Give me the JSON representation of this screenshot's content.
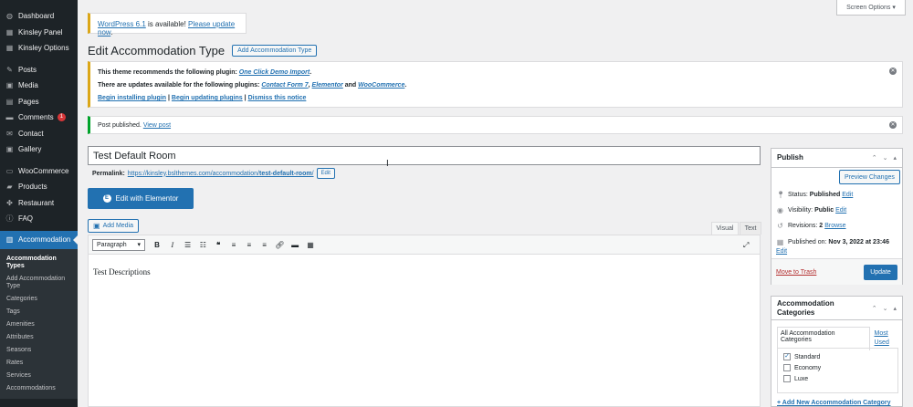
{
  "sidebar": {
    "items_top": [
      {
        "label": "Dashboard",
        "icon": "dashboard-icon",
        "glyph": "◍"
      },
      {
        "label": "Kinsley Panel",
        "icon": "panel-icon",
        "glyph": "▦"
      },
      {
        "label": "Kinsley Options",
        "icon": "options-icon",
        "glyph": "▦"
      }
    ],
    "items_mid": [
      {
        "label": "Posts",
        "icon": "pin-icon",
        "glyph": "✎"
      },
      {
        "label": "Media",
        "icon": "media-icon",
        "glyph": "▣"
      },
      {
        "label": "Pages",
        "icon": "pages-icon",
        "glyph": "▤"
      },
      {
        "label": "Comments",
        "icon": "comments-icon",
        "glyph": "▬",
        "badge": "1"
      },
      {
        "label": "Contact",
        "icon": "mail-icon",
        "glyph": "✉"
      },
      {
        "label": "Gallery",
        "icon": "gallery-icon",
        "glyph": "▣"
      }
    ],
    "items_bottom": [
      {
        "label": "WooCommerce",
        "icon": "woocommerce-icon",
        "glyph": "▭"
      },
      {
        "label": "Products",
        "icon": "products-icon",
        "glyph": "▰"
      },
      {
        "label": "Restaurant",
        "icon": "restaurant-icon",
        "glyph": "✤"
      },
      {
        "label": "FAQ",
        "icon": "faq-icon",
        "glyph": "ⓘ"
      }
    ],
    "active": {
      "label": "Accommodation",
      "icon": "accommodation-icon",
      "glyph": "▥"
    },
    "submenu": [
      "Accommodation Types",
      "Add Accommodation Type",
      "Categories",
      "Tags",
      "Amenities",
      "Attributes",
      "Seasons",
      "Rates",
      "Services",
      "Accommodations"
    ]
  },
  "screen_options": "Screen Options ▾",
  "update_nag": {
    "link": "WordPress 6.1",
    "middle": " is available! ",
    "link2": "Please update now",
    "end": "."
  },
  "heading": {
    "title": "Edit Accommodation Type",
    "add_button": "Add Accommodation Type"
  },
  "theme_notice": {
    "line1_prefix": "This theme recommends the following plugin: ",
    "line1_plugin": "One Click Demo Import",
    "line2_prefix": "There are updates available for the following plugins: ",
    "line2_p1": "Contact Form 7",
    "line2_p2": "Elementor",
    "line2_and": " and ",
    "line2_p3": "WooCommerce",
    "link_install": "Begin installing plugin",
    "link_update": "Begin updating plugins",
    "link_dismiss": "Dismiss this notice",
    "sep": " | "
  },
  "published_notice": {
    "text": "Post published. ",
    "link": "View post"
  },
  "post": {
    "title": "Test Default Room",
    "permalink_label": "Permalink:",
    "permalink_base": "https://kinsley.bslthemes.com/accommodation/",
    "permalink_slug": "test-default-room",
    "permalink_end": "/",
    "edit_label": "Edit",
    "elementor_label": "Edit with Elementor",
    "content": "Test Descriptions"
  },
  "editor": {
    "add_media": "Add Media",
    "tab_visual": "Visual",
    "tab_text": "Text",
    "format": "Paragraph"
  },
  "publish": {
    "title": "Publish",
    "preview": "Preview Changes",
    "status_label": "Status:",
    "status_value": "Published",
    "visibility_label": "Visibility:",
    "visibility_value": "Public",
    "revisions_label": "Revisions:",
    "revisions_value": "2",
    "browse": "Browse",
    "published_on_label": "Published on:",
    "published_on_value": "Nov 3, 2022 at 23:46",
    "edit": "Edit",
    "trash": "Move to Trash",
    "update": "Update"
  },
  "categories": {
    "title": "Accommodation Categories",
    "tab_all": "All Accommodation Categories",
    "tab_most": "Most Used",
    "items": [
      {
        "label": "Standard",
        "checked": true
      },
      {
        "label": "Economy",
        "checked": false
      },
      {
        "label": "Luxe",
        "checked": false
      }
    ],
    "add_new": "+ Add New Accommodation Category"
  }
}
